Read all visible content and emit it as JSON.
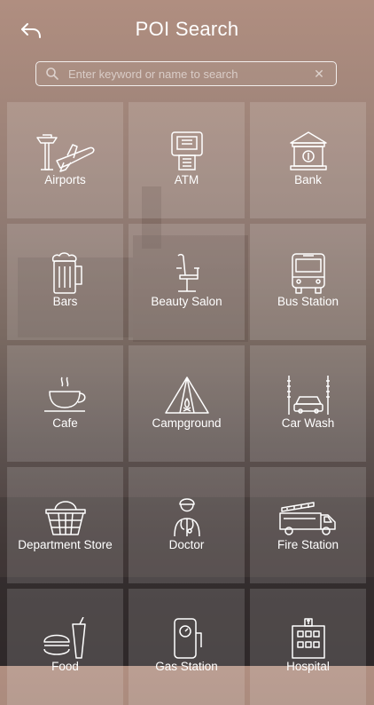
{
  "header": {
    "title": "POI Search"
  },
  "search": {
    "placeholder": "Enter keyword or name to search",
    "value": ""
  },
  "categories": [
    {
      "label": "Airports"
    },
    {
      "label": "ATM"
    },
    {
      "label": "Bank"
    },
    {
      "label": "Bars"
    },
    {
      "label": "Beauty Salon"
    },
    {
      "label": "Bus Station"
    },
    {
      "label": "Cafe"
    },
    {
      "label": "Campground"
    },
    {
      "label": "Car Wash"
    },
    {
      "label": "Department Store"
    },
    {
      "label": "Doctor"
    },
    {
      "label": "Fire Station"
    },
    {
      "label": "Food"
    },
    {
      "label": "Gas Station"
    },
    {
      "label": "Hospital"
    }
  ],
  "icons": [
    "airport-icon",
    "atm-icon",
    "bank-icon",
    "beer-icon",
    "salon-chair-icon",
    "bus-icon",
    "coffee-cup-icon",
    "tent-icon",
    "car-wash-icon",
    "basket-icon",
    "doctor-icon",
    "fire-truck-icon",
    "fast-food-icon",
    "gas-pump-icon",
    "hospital-icon"
  ]
}
